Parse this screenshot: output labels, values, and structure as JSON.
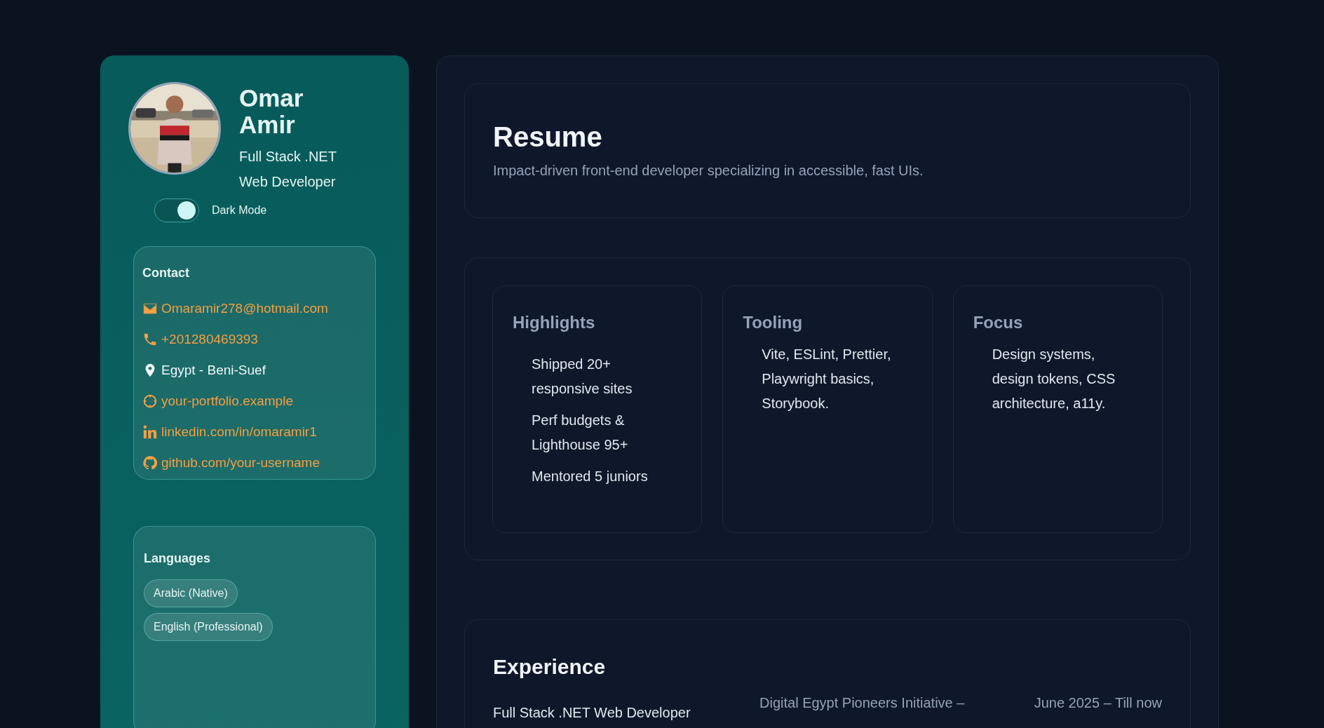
{
  "profile": {
    "name": "Omar Amir",
    "title": "Full Stack .NET Web Developer",
    "dark_mode": {
      "label": "Dark Mode",
      "on": true
    }
  },
  "contact": {
    "heading": "Contact",
    "items": [
      {
        "kind": "email",
        "text": "Omaramir278@hotmail.com"
      },
      {
        "kind": "phone",
        "text": "+201280469393"
      },
      {
        "kind": "location",
        "text": "Egypt - Beni-Suef"
      },
      {
        "kind": "website",
        "text": "your-portfolio.example"
      },
      {
        "kind": "linkedin",
        "text": "linkedin.com/in/omaramir1"
      },
      {
        "kind": "github",
        "text": "github.com/your-username"
      }
    ]
  },
  "languages": {
    "heading": "Languages",
    "items": [
      "Arabic (Native)",
      "English (Professional)"
    ]
  },
  "resume": {
    "title": "Resume",
    "subtitle": "Impact-driven front-end developer specializing in accessible, fast UIs."
  },
  "summary_cards": [
    {
      "title": "Highlights",
      "kind": "list",
      "items": [
        "Shipped 20+ responsive sites",
        "Perf budgets & Lighthouse 95+",
        "Mentored 5 juniors"
      ]
    },
    {
      "title": "Tooling",
      "kind": "text",
      "text": "Vite, ESLint, Prettier, Playwright basics, Storybook."
    },
    {
      "title": "Focus",
      "kind": "text",
      "text": "Design systems, design tokens, CSS architecture, a11y."
    }
  ],
  "experience": {
    "title": "Experience",
    "entries": [
      {
        "role": "Full Stack .NET Web Developer",
        "organization": "Digital Egypt Pioneers Initiative –",
        "dates": "June 2025 – Till now"
      }
    ]
  }
}
